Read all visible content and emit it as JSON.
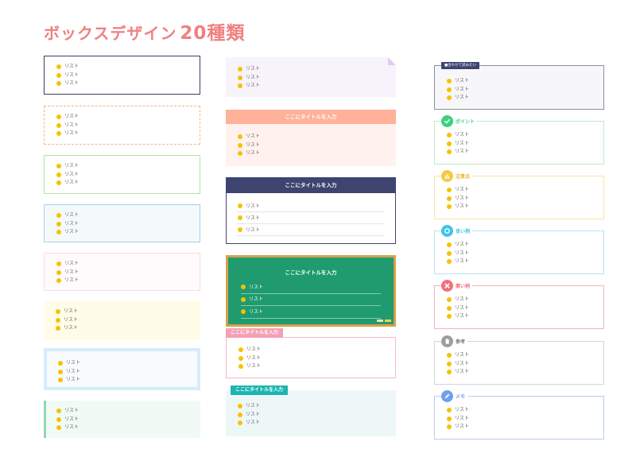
{
  "page": {
    "title": "ボックスデザイン",
    "count": "20種類"
  },
  "item_text": "リスト",
  "title_text": "ここにタイトルを入力",
  "col3": {
    "box1_label": "■合わせて読みたい",
    "point_label": "ポイント",
    "caution_label": "注意点",
    "good_label": "良い例",
    "bad_label": "悪い例",
    "ref_label": "参考",
    "memo_label": "メモ"
  },
  "icons": {
    "point": "check-icon",
    "caution": "warning-icon",
    "good": "circle-icon",
    "bad": "cross-icon",
    "ref": "document-icon",
    "memo": "pencil-icon"
  },
  "colors": {
    "title": "#f08080",
    "bullet": "#f5c200",
    "navy": "#3d4470",
    "green_board": "#1f9b6f",
    "salmon": "#ffb199",
    "pink": "#f5a0b5",
    "teal": "#1cb5b0",
    "point": "#3fcf7f",
    "caution": "#f7c843",
    "good": "#3ec4e8",
    "bad": "#f1707a",
    "ref": "#9e9e9e",
    "memo": "#6fa0ec"
  }
}
